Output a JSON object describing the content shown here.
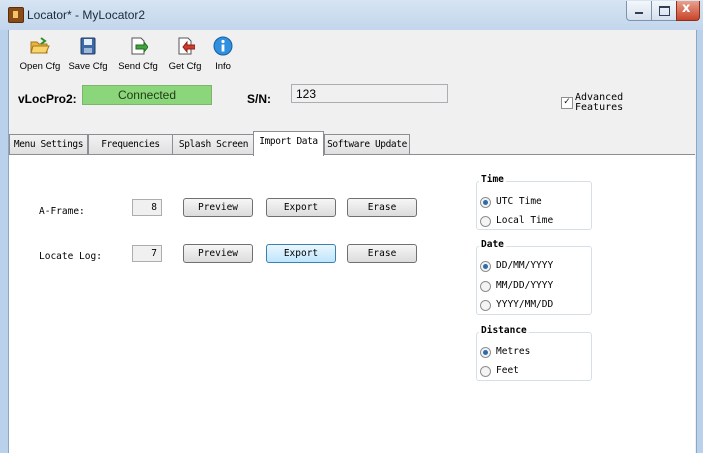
{
  "window": {
    "title": "Locator* - MyLocator2",
    "close_glyph": "x"
  },
  "toolbar": {
    "items": [
      {
        "label": "Open Cfg",
        "icon": "folder-open-icon"
      },
      {
        "label": "Save Cfg",
        "icon": "save-icon"
      },
      {
        "label": "Send Cfg",
        "icon": "send-icon"
      },
      {
        "label": "Get Cfg",
        "icon": "get-icon"
      },
      {
        "label": "Info",
        "icon": "info-icon"
      }
    ]
  },
  "device": {
    "label": "vLocPro2:",
    "status": "Connected",
    "status_color": "#8bd57a",
    "sn_label": "S/N:",
    "sn_value": "123"
  },
  "advanced": {
    "label": "Advanced Features",
    "checked": true,
    "check_glyph": "✓"
  },
  "tabs": [
    "Menu Settings",
    "Frequencies",
    "Splash Screen",
    "Import Data",
    "Software Update"
  ],
  "active_tab": "Import Data",
  "rows": [
    {
      "label": "A-Frame:",
      "count": "8",
      "preview": "Preview",
      "export": "Export",
      "erase": "Erase"
    },
    {
      "label": "Locate Log:",
      "count": "7",
      "preview": "Preview",
      "export": "Export",
      "erase": "Erase"
    }
  ],
  "groups": {
    "time": {
      "title": "Time",
      "options": [
        "UTC Time",
        "Local Time"
      ],
      "selected": "UTC Time"
    },
    "date": {
      "title": "Date",
      "options": [
        "DD/MM/YYYY",
        "MM/DD/YYYY",
        "YYYY/MM/DD"
      ],
      "selected": "DD/MM/YYYY"
    },
    "distance": {
      "title": "Distance",
      "options": [
        "Metres",
        "Feet"
      ],
      "selected": "Metres"
    }
  }
}
